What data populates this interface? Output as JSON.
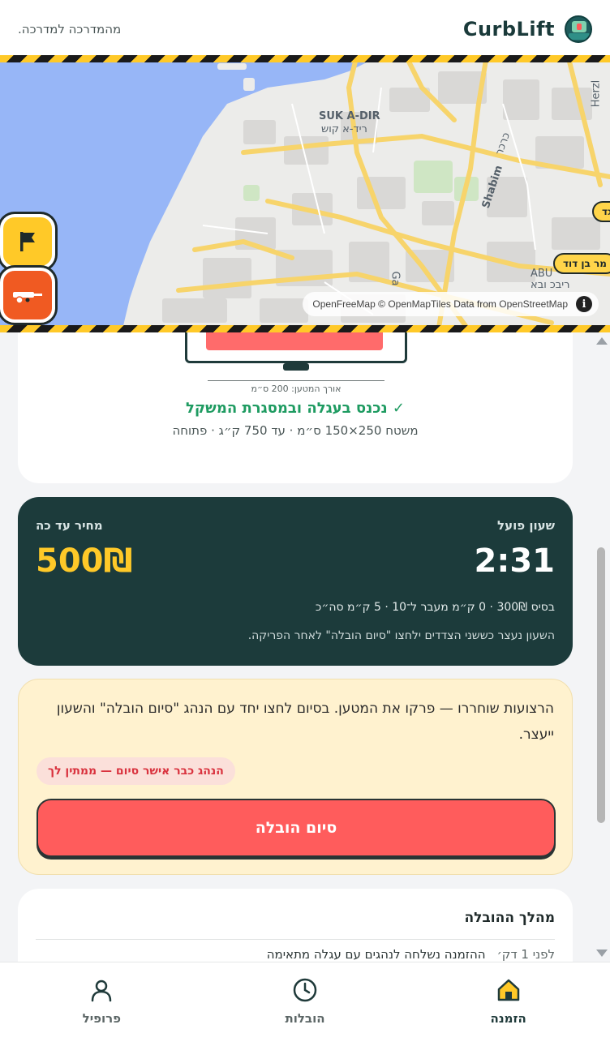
{
  "header": {
    "brand": "CurbLift",
    "subtitle": "מהמדרכה למדרכה."
  },
  "map": {
    "labels": {
      "suk_latin": "SUK A-DIR",
      "suk_hebrew": "ריד-א קוש",
      "street_shabim": "Shabim",
      "street_herzl": "Herzl",
      "abu": "ABU",
      "street_gaza": "Ga",
      "hebrew_street_1": "כרכר",
      "hebrew_street_2": "ריבכ ובא"
    },
    "street_tags": [
      "מר בן דוד",
      "גד"
    ],
    "attribution": {
      "openfreemap": "OpenFreeMap",
      "copy": "©",
      "openmaptiles": "OpenMapTiles",
      "data_from": "Data from",
      "osm": "OpenStreetMap"
    },
    "fab_flag_icon": "flag-icon",
    "fab_tow_icon": "tow-truck-icon"
  },
  "vehicle_card": {
    "measure_label": "אורך המטען: 200 ס״מ",
    "fit_status": "✓ נכנס בעגלה ובמסגרת המשקל",
    "spec": "משטח 250×150 ס״מ · עד 750 ק״ג · פתוחה"
  },
  "timer_card": {
    "timer_label": "שעון פועל",
    "timer_value": "2:31",
    "price_label": "מחיר עד כה",
    "price_value": "500₪",
    "rate_line": "בסיס 300₪ · 0 ק״מ מעבר ל־10 · 5 ק״מ סה״כ",
    "rate_note": "השעון נעצר כששני הצדדים ילחצו \"סיום הובלה\" לאחר הפריקה."
  },
  "action_card": {
    "text": "הרצועות שוחררו — פרקו את המטען. בסיום לחצו יחד עם הנהג \"סיום הובלה\" והשעון ייעצר.",
    "driver_status": "הנהג כבר אישר סיום — ממתין לך",
    "finish_button": "סיום הובלה"
  },
  "timeline_card": {
    "title": "מהלך ההובלה",
    "events": [
      {
        "time": "לפני 1 דק׳",
        "text": "ההזמנה נשלחה לנהגים עם עגלה מתאימה"
      }
    ]
  },
  "bottom_nav": {
    "items": [
      {
        "label": "הזמנה",
        "icon": "home-icon",
        "active": true
      },
      {
        "label": "הובלות",
        "icon": "clock-icon",
        "active": false
      },
      {
        "label": "פרופיל",
        "icon": "user-icon",
        "active": false
      }
    ]
  },
  "colors": {
    "brand_dark": "#1c3b3b",
    "accent_yellow": "#ffc928",
    "action_red": "#ff5c5c",
    "success_green": "#1e9b61"
  }
}
